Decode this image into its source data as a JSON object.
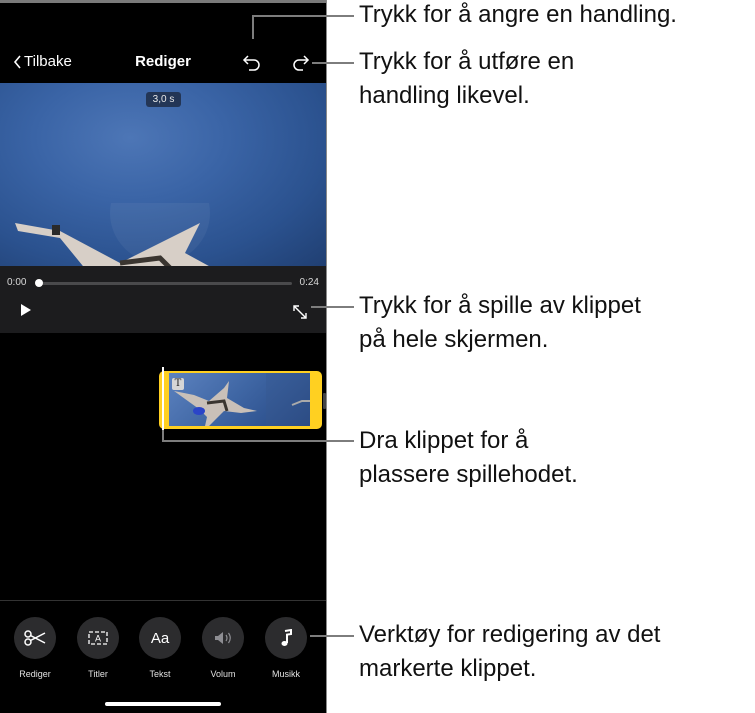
{
  "nav": {
    "back_label": "Tilbake",
    "title": "Rediger",
    "undo_icon": "undo-arrow-icon",
    "redo_icon": "redo-arrow-icon"
  },
  "viewer": {
    "clip_duration_badge": "3,0 s",
    "time_current": "0:00",
    "time_total": "0:24",
    "playback_progress": 0.0,
    "play_icon": "play-icon",
    "fullscreen_icon": "expand-arrows-icon"
  },
  "timeline": {
    "clip_title_badge": "T",
    "selected_clip_color": "#ffd021"
  },
  "toolbar": {
    "tools": [
      {
        "label": "Rediger",
        "icon": "scissors-icon"
      },
      {
        "label": "Titler",
        "icon": "titles-icon"
      },
      {
        "label": "Tekst",
        "icon": "text-aa-icon",
        "glyph": "Aa"
      },
      {
        "label": "Volum",
        "icon": "speaker-icon",
        "disabled": true
      },
      {
        "label": "Musikk",
        "icon": "music-note-icon"
      }
    ]
  },
  "callouts": {
    "undo": [
      "Trykk for å angre en handling."
    ],
    "redo": [
      "Trykk for å utføre en",
      "handling likevel."
    ],
    "fullscreen": [
      "Trykk for å spille av klippet",
      "på hele skjermen."
    ],
    "playhead": [
      "Dra klippet for å",
      "plassere spillehodet."
    ],
    "tools": [
      "Verktøy for redigering av det",
      "markerte klippet."
    ]
  }
}
